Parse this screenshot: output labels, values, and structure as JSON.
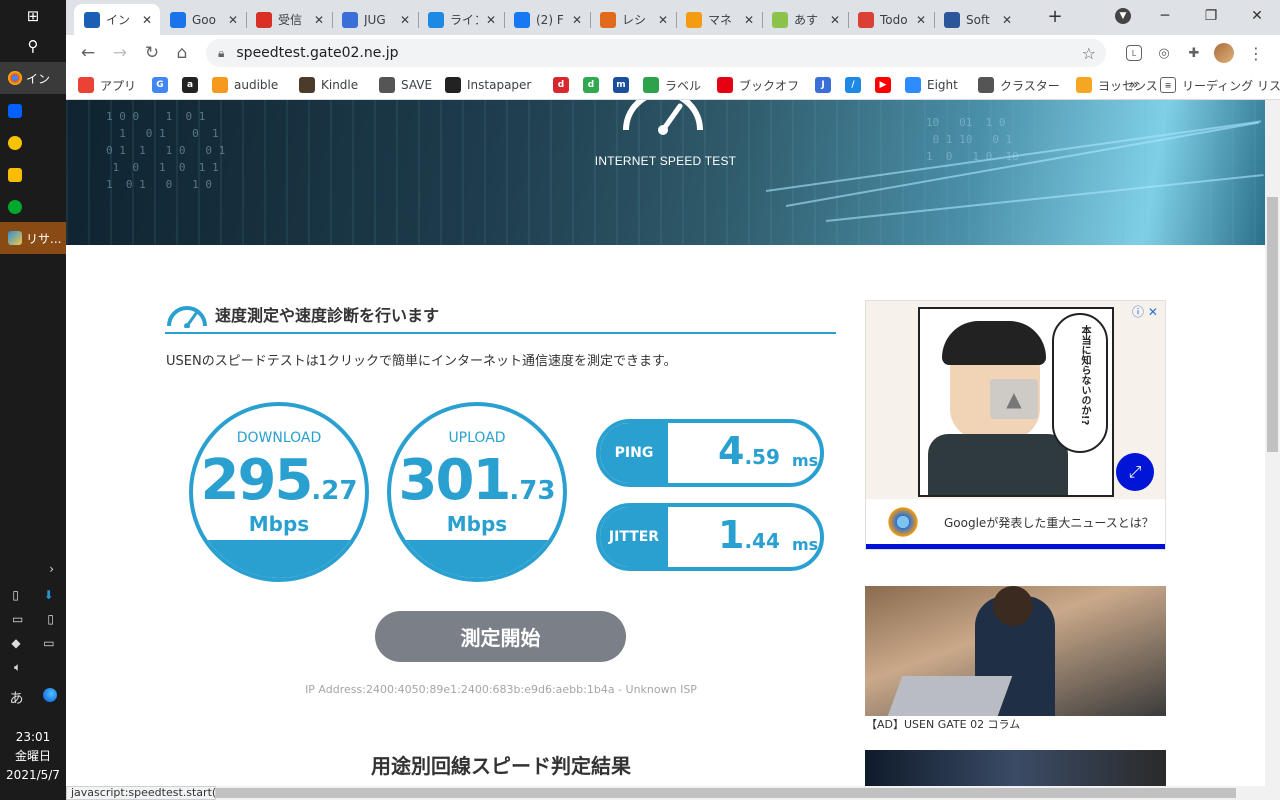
{
  "taskbar": {
    "apps": [
      {
        "name": "chrome",
        "label": "イン"
      },
      {
        "name": "dropbox",
        "label": ""
      },
      {
        "name": "norton",
        "label": ""
      },
      {
        "name": "keep",
        "label": ""
      },
      {
        "name": "evernote",
        "label": ""
      },
      {
        "name": "risa",
        "label": "リサ..."
      }
    ],
    "ime": "あ",
    "clock": {
      "time": "23:01",
      "day": "金曜日",
      "date": "2021/5/7"
    }
  },
  "tabs": [
    {
      "label": "イン",
      "color": "#1a5fb4",
      "active": true
    },
    {
      "label": "Goo",
      "color": "#1a73e8"
    },
    {
      "label": "受信",
      "color": "#d93025"
    },
    {
      "label": "JUG",
      "color": "#3a6fd8"
    },
    {
      "label": "ライン",
      "color": "#1e88e5"
    },
    {
      "label": "(2) F",
      "color": "#1877f2"
    },
    {
      "label": "レシ",
      "color": "#e06b1f"
    },
    {
      "label": "マネ",
      "color": "#f39c12"
    },
    {
      "label": "あす",
      "color": "#8bc34a"
    },
    {
      "label": "Todo",
      "color": "#db4035"
    },
    {
      "label": "Soft",
      "color": "#2b579a"
    }
  ],
  "address": {
    "url": "speedtest.gate02.ne.jp"
  },
  "bookmarks": [
    {
      "label": "アプリ",
      "color": "#ea4335"
    },
    {
      "label": "",
      "color": "#4285f4",
      "glyph": "G"
    },
    {
      "label": "",
      "color": "#222222",
      "glyph": "a"
    },
    {
      "label": "audible",
      "color": "#f7991c"
    },
    {
      "label": "Kindle",
      "color": "#4b3b2a"
    },
    {
      "label": "SAVE",
      "color": "#555555"
    },
    {
      "label": "Instapaper",
      "color": "#222222"
    },
    {
      "label": "",
      "color": "#d9272e",
      "glyph": "d"
    },
    {
      "label": "",
      "color": "#33a852",
      "glyph": "d"
    },
    {
      "label": "",
      "color": "#1b4f9c",
      "glyph": "m"
    },
    {
      "label": "ラベル",
      "color": "#2ca34a"
    },
    {
      "label": "ブックオフ",
      "color": "#e60012"
    },
    {
      "label": "",
      "color": "#3a6fd8",
      "glyph": "J"
    },
    {
      "label": "",
      "color": "#1e88e5",
      "glyph": "/"
    },
    {
      "label": "",
      "color": "#ff0000",
      "glyph": "▶"
    },
    {
      "label": "Eight",
      "color": "#2d8cff"
    },
    {
      "label": "クラスター",
      "color": "#555555"
    },
    {
      "label": "ヨッセンス",
      "color": "#f5a623"
    }
  ],
  "bookmarks_more": "»",
  "reading_list": "リーディング リスト",
  "page": {
    "hero_title": "INTERNET SPEED TEST",
    "section_title": "速度測定や速度診断を行います",
    "section_desc": "USENのスピードテストは1クリックで簡単にインターネット通信速度を測定できます。",
    "download": {
      "label": "DOWNLOAD",
      "int": "295",
      "dec": ".27",
      "unit": "Mbps"
    },
    "upload": {
      "label": "UPLOAD",
      "int": "301",
      "dec": ".73",
      "unit": "Mbps"
    },
    "ping": {
      "label": "PING",
      "int": "4",
      "dec": ".59",
      "unit": "ms"
    },
    "jitter": {
      "label": "JITTER",
      "int": "1",
      "dec": ".44",
      "unit": "ms"
    },
    "start_button": "測定開始",
    "ip_line": "IP Address:2400:4050:89e1:2400:683b:e9d6:aebb:1b4a - Unknown ISP",
    "result_title": "用途別回線スピード判定結果"
  },
  "ads": {
    "comic_text": "本当に知らないのか!?",
    "bottom_text": "Googleが発表した重大ニュースとは？",
    "column_caption": "【AD】USEN GATE 02 コラム"
  },
  "status_bar": "javascript:speedtest.start();"
}
